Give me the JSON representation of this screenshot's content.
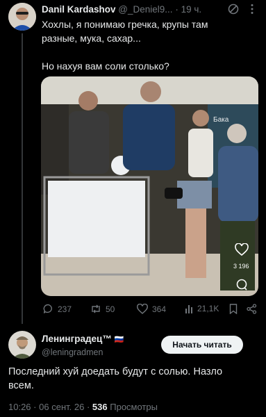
{
  "quoted_tweet": {
    "author_name": "Danil Kardashov",
    "handle": "@_Deniel9...",
    "separator": "·",
    "time": "19 ч.",
    "text_line1": "Хохлы, я понимаю гречка, крупы там",
    "text_line2": "разные, мука, сахар...",
    "text_line3": "Но нахуя вам соли столько?",
    "photo_store_sign": "Бака",
    "photo_overlay_likes": "3 196",
    "metrics": {
      "replies": "237",
      "reposts": "50",
      "likes": "364",
      "views": "21,1K"
    }
  },
  "reply": {
    "author_name": "Ленинградец™",
    "flag": "🇷🇺",
    "handle": "@leningradmen",
    "follow_label": "Начать читать",
    "text_line1": "Последний хуй доедать будут с солью. Назло",
    "text_line2": "всем.",
    "time": "10:26",
    "date": "06 сент. 26",
    "views_count": "536",
    "views_label": "Просмотры"
  },
  "colors": {
    "background": "#000000",
    "text": "#e7e9ea",
    "muted": "#71767b",
    "follow_button_bg": "#eff3f4"
  }
}
